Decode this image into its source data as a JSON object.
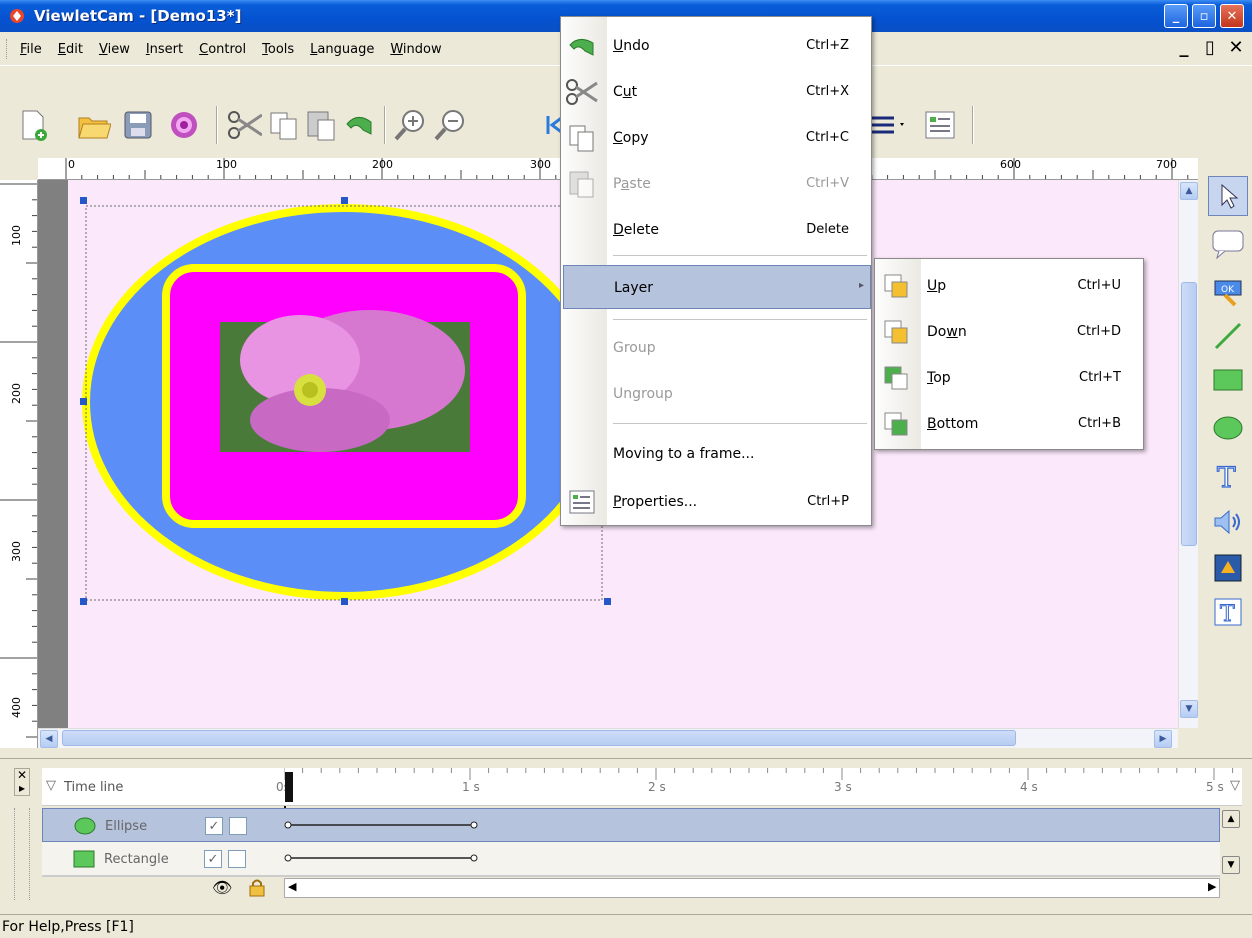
{
  "window": {
    "title": "ViewletCam - [Demo13*]"
  },
  "menubar": [
    {
      "label": "File",
      "u": "F",
      "rest": "ile"
    },
    {
      "label": "Edit",
      "u": "E",
      "rest": "dit"
    },
    {
      "label": "View",
      "u": "V",
      "rest": "iew"
    },
    {
      "label": "Insert",
      "u": "I",
      "rest": "nsert"
    },
    {
      "label": "Control",
      "u": "C",
      "rest": "ontrol"
    },
    {
      "label": "Tools",
      "u": "T",
      "rest": "ools"
    },
    {
      "label": "Language",
      "u": "L",
      "rest": "anguage"
    },
    {
      "label": "Window",
      "u": "W",
      "rest": "indow"
    }
  ],
  "ruler": {
    "top": [
      "0",
      "100",
      "200",
      "300",
      "600",
      "700"
    ],
    "left": [
      "100",
      "200",
      "300",
      "400"
    ]
  },
  "context_menu": {
    "items": [
      {
        "pre": "",
        "u": "U",
        "post": "ndo",
        "shortcut": "Ctrl+Z",
        "icon": "undo-icon"
      },
      {
        "pre": "C",
        "u": "u",
        "post": "t",
        "shortcut": "Ctrl+X",
        "icon": "scissors-icon"
      },
      {
        "pre": "",
        "u": "C",
        "post": "opy",
        "shortcut": "Ctrl+C",
        "icon": "copy-icon"
      },
      {
        "pre": "P",
        "u": "a",
        "post": "ste",
        "shortcut": "Ctrl+V",
        "icon": "paste-icon"
      },
      {
        "pre": "",
        "u": "D",
        "post": "elete",
        "shortcut": "Delete",
        "icon": ""
      }
    ],
    "layer": "Layer",
    "group": "Group",
    "ungroup": "Ungroup",
    "moving": "Moving to a frame...",
    "properties": {
      "pre": "",
      "u": "P",
      "post": "roperties...",
      "shortcut": "Ctrl+P"
    }
  },
  "layer_submenu": [
    {
      "pre": "",
      "u": "U",
      "post": "p",
      "shortcut": "Ctrl+U",
      "icon": "layer-up-icon"
    },
    {
      "pre": "Do",
      "u": "w",
      "post": "n",
      "shortcut": "Ctrl+D",
      "icon": "layer-down-icon"
    },
    {
      "pre": "",
      "u": "T",
      "post": "op",
      "shortcut": "Ctrl+T",
      "icon": "layer-top-icon"
    },
    {
      "pre": "",
      "u": "B",
      "post": "ottom",
      "shortcut": "Ctrl+B",
      "icon": "layer-bottom-icon"
    }
  ],
  "timeline": {
    "header": "Time line",
    "ticks": [
      "0s",
      "1 s",
      "2 s",
      "3 s",
      "4 s",
      "5 s"
    ],
    "rows": [
      {
        "name": "Ellipse",
        "visible": true,
        "locked": false
      },
      {
        "name": "Rectangle",
        "visible": true,
        "locked": false
      }
    ]
  },
  "status": "For Help,Press [F1]",
  "colors": {
    "ellipse_fill": "#5b8ef7",
    "ellipse_border": "#ffff00",
    "rect_fill": "#ff00ff",
    "canvas": "#fbe8fb",
    "selection": "#b6c3dd"
  }
}
